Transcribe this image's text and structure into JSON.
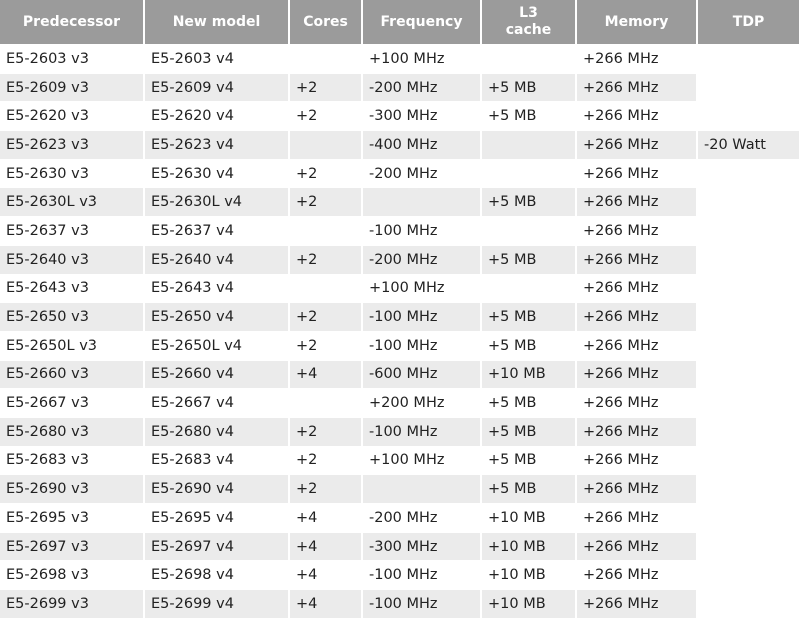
{
  "headers": [
    "Predecessor",
    "New model",
    "Cores",
    "Frequency",
    "L3\ncache",
    "Memory",
    "TDP"
  ],
  "rows": [
    [
      "E5-2603 v3",
      "E5-2603 v4",
      "",
      "+100 MHz",
      "",
      "+266 MHz",
      ""
    ],
    [
      "E5-2609 v3",
      "E5-2609 v4",
      "+2",
      "-200 MHz",
      "+5 MB",
      "+266 MHz",
      ""
    ],
    [
      "E5-2620 v3",
      "E5-2620 v4",
      "+2",
      "-300 MHz",
      "+5 MB",
      "+266 MHz",
      ""
    ],
    [
      "E5-2623 v3",
      "E5-2623 v4",
      "",
      "-400 MHz",
      "",
      "+266 MHz",
      "-20 Watt"
    ],
    [
      "E5-2630 v3",
      "E5-2630 v4",
      "+2",
      "-200 MHz",
      "",
      "+266 MHz",
      ""
    ],
    [
      "E5-2630L v3",
      "E5-2630L v4",
      "+2",
      "",
      "+5 MB",
      "+266 MHz",
      ""
    ],
    [
      "E5-2637 v3",
      "E5-2637 v4",
      "",
      "-100 MHz",
      "",
      "+266 MHz",
      ""
    ],
    [
      "E5-2640 v3",
      "E5-2640 v4",
      "+2",
      "-200 MHz",
      "+5 MB",
      "+266 MHz",
      ""
    ],
    [
      "E5-2643 v3",
      "E5-2643 v4",
      "",
      "+100 MHz",
      "",
      "+266 MHz",
      ""
    ],
    [
      "E5-2650 v3",
      "E5-2650 v4",
      "+2",
      "-100 MHz",
      "+5 MB",
      "+266 MHz",
      ""
    ],
    [
      "E5-2650L v3",
      "E5-2650L v4",
      "+2",
      "-100 MHz",
      "+5 MB",
      "+266 MHz",
      ""
    ],
    [
      "E5-2660 v3",
      "E5-2660 v4",
      "+4",
      "-600 MHz",
      "+10 MB",
      "+266 MHz",
      ""
    ],
    [
      "E5-2667 v3",
      "E5-2667 v4",
      "",
      "+200 MHz",
      "+5 MB",
      "+266 MHz",
      ""
    ],
    [
      "E5-2680 v3",
      "E5-2680 v4",
      "+2",
      "-100 MHz",
      "+5 MB",
      "+266 MHz",
      ""
    ],
    [
      "E5-2683 v3",
      "E5-2683 v4",
      "+2",
      "+100 MHz",
      "+5 MB",
      "+266 MHz",
      ""
    ],
    [
      "E5-2690 v3",
      "E5-2690 v4",
      "+2",
      "",
      "+5 MB",
      "+266 MHz",
      ""
    ],
    [
      "E5-2695 v3",
      "E5-2695 v4",
      "+4",
      "-200 MHz",
      "+10 MB",
      "+266 MHz",
      ""
    ],
    [
      "E5-2697 v3",
      "E5-2697 v4",
      "+4",
      "-300 MHz",
      "+10 MB",
      "+266 MHz",
      ""
    ],
    [
      "E5-2698 v3",
      "E5-2698 v4",
      "+4",
      "-100 MHz",
      "+10 MB",
      "+266 MHz",
      ""
    ],
    [
      "E5-2699 v3",
      "E5-2699 v4",
      "+4",
      "-100 MHz",
      "+10 MB",
      "+266 MHz",
      ""
    ]
  ],
  "colors": {
    "header_bg": "#9b9b9b",
    "alt_row_bg": "#ebebeb"
  }
}
